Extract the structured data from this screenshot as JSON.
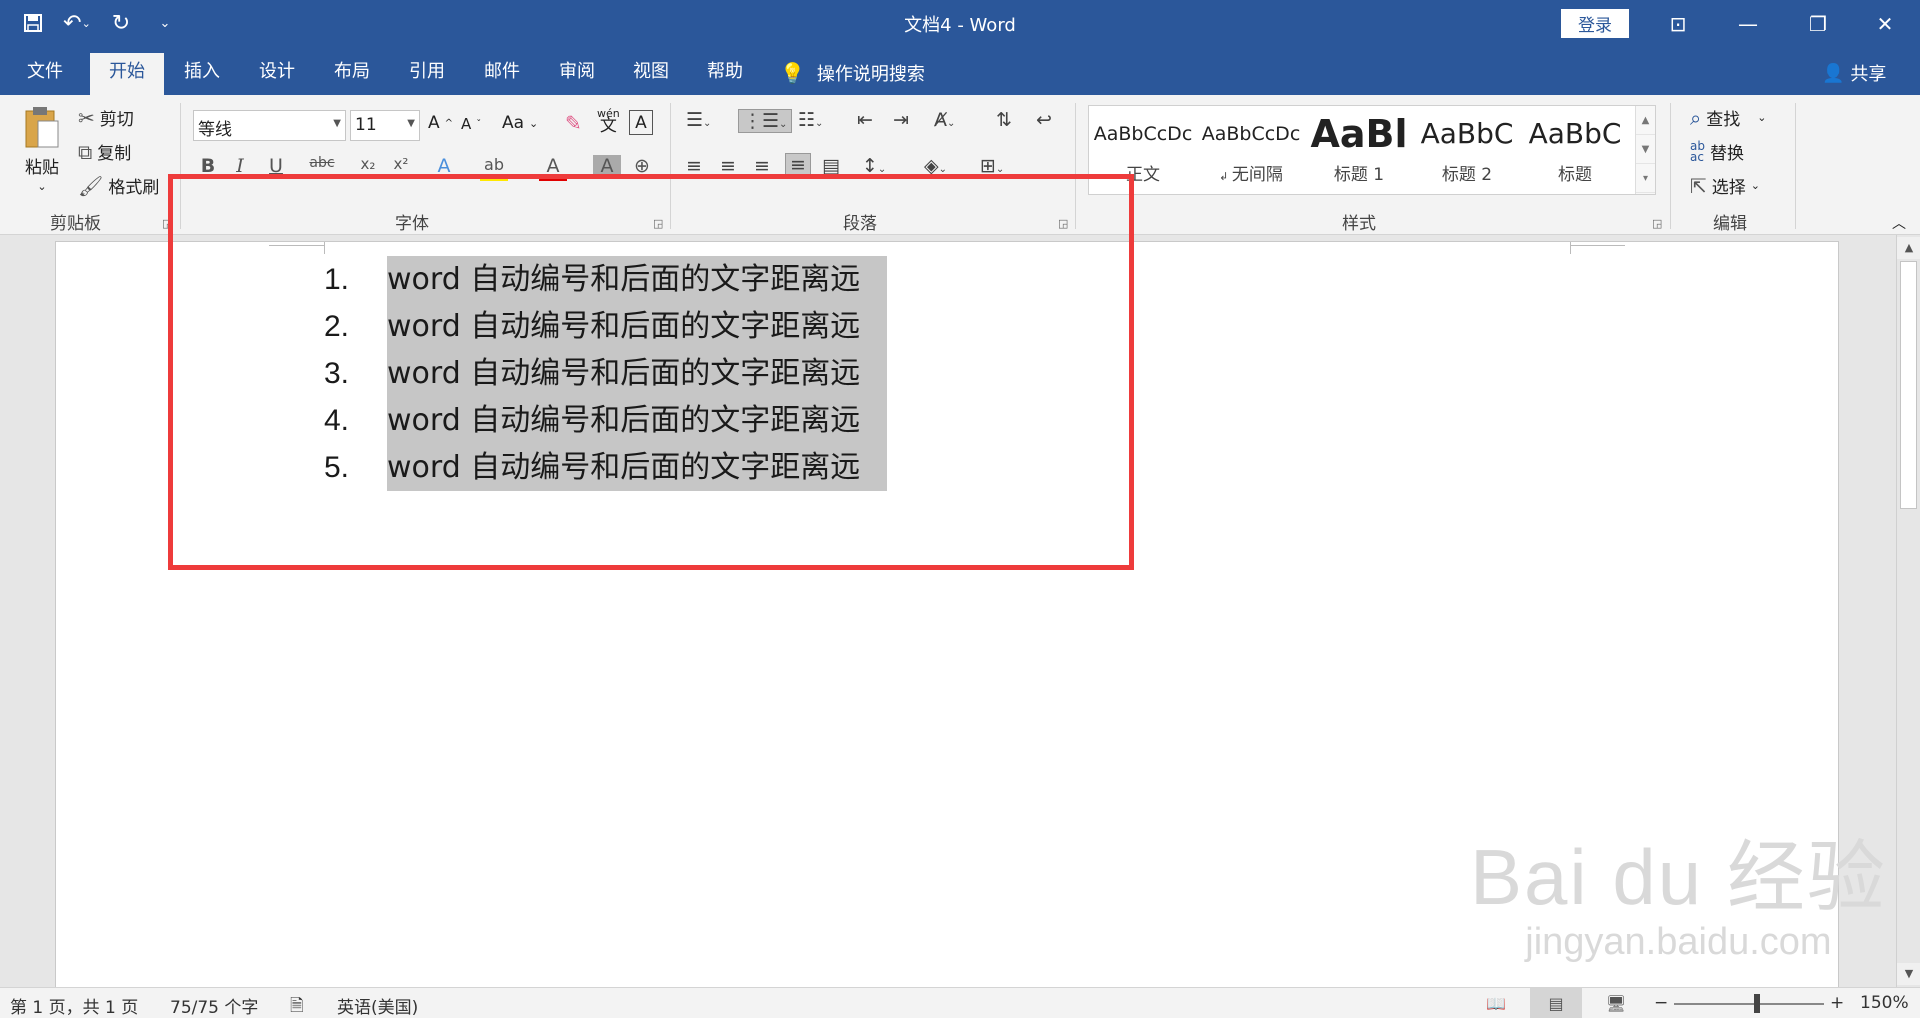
{
  "window": {
    "title": "文档4  -  Word",
    "login_label": "登录",
    "qat_icons": [
      "save-icon",
      "undo-icon",
      "redo-icon",
      "customize-icon"
    ]
  },
  "tabs": [
    "文件",
    "开始",
    "插入",
    "设计",
    "布局",
    "引用",
    "邮件",
    "审阅",
    "视图",
    "帮助"
  ],
  "active_tab": "开始",
  "tell_me": "操作说明搜索",
  "share_label": "共享",
  "clipboard": {
    "paste": "粘贴",
    "cut": "剪切",
    "copy": "复制",
    "format_painter": "格式刷",
    "group_label": "剪贴板"
  },
  "font": {
    "name": "等线",
    "size": "11",
    "change_case": "Aa",
    "group_label": "字体",
    "phonetic_top": "wén",
    "phonetic_bottom": "文"
  },
  "paragraph": {
    "group_label": "段落"
  },
  "styles": {
    "group_label": "样式",
    "items": [
      {
        "sample": "AaBbCcDc",
        "name": "正文"
      },
      {
        "sample": "AaBbCcDc",
        "name": "无间隔"
      },
      {
        "sample": "AaBl",
        "name": "标题 1"
      },
      {
        "sample": "AaBbC",
        "name": "标题 2"
      },
      {
        "sample": "AaBbC",
        "name": "标题"
      }
    ]
  },
  "editing": {
    "find": "查找",
    "replace": "替换",
    "select": "选择",
    "group_label": "编辑"
  },
  "document": {
    "list": [
      {
        "num": "1.",
        "text": "word 自动编号和后面的文字距离远"
      },
      {
        "num": "2.",
        "text": "word 自动编号和后面的文字距离远"
      },
      {
        "num": "3.",
        "text": "word 自动编号和后面的文字距离远"
      },
      {
        "num": "4.",
        "text": "word 自动编号和后面的文字距离远"
      },
      {
        "num": "5.",
        "text": "word 自动编号和后面的文字距离远"
      }
    ],
    "highlight_color": "#c6c6c6",
    "annotation_color": "#ee3b3b"
  },
  "watermark": {
    "big": "Bai du 经验",
    "small": "jingyan.baidu.com"
  },
  "status": {
    "page": "第 1 页，共 1 页",
    "words": "75/75 个字",
    "language": "英语(美国)",
    "zoom": "150%"
  },
  "colors": {
    "brand": "#2b579a",
    "ribbon": "#f3f3f3"
  }
}
